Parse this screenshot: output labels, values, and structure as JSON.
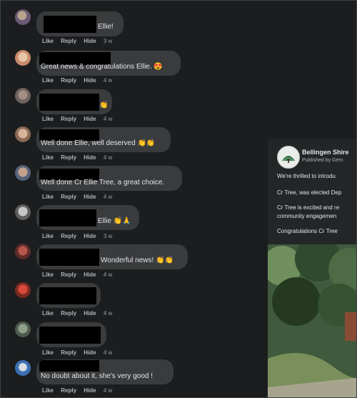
{
  "comments": [
    {
      "text": "Ellie!",
      "actions": {
        "like": "Like",
        "reply": "Reply",
        "hide": "Hide",
        "time": "3 w"
      }
    },
    {
      "text": "Great news & congratulations Ellie. 😍",
      "actions": {
        "like": "Like",
        "reply": "Reply",
        "hide": "Hide",
        "time": "4 w"
      }
    },
    {
      "text": "👏",
      "actions": {
        "like": "Like",
        "reply": "Reply",
        "hide": "Hide",
        "time": "4 w"
      }
    },
    {
      "text": "Well done Ellie, well deserved 👏👏",
      "actions": {
        "like": "Like",
        "reply": "Reply",
        "hide": "Hide",
        "time": "4 w"
      }
    },
    {
      "text": "Well done Cr Ellie Tree, a great choice.",
      "actions": {
        "like": "Like",
        "reply": "Reply",
        "hide": "Hide",
        "time": "4 w"
      }
    },
    {
      "text": "Ellie 👏🙏",
      "actions": {
        "like": "Like",
        "reply": "Reply",
        "hide": "Hide",
        "time": "3 w"
      }
    },
    {
      "text": "Wonderful news! 👏👏",
      "actions": {
        "like": "Like",
        "reply": "Reply",
        "hide": "Hide",
        "time": "4 w"
      }
    },
    {
      "text": "",
      "actions": {
        "like": "Like",
        "reply": "Reply",
        "hide": "Hide",
        "time": "4 w"
      }
    },
    {
      "text": "",
      "actions": {
        "like": "Like",
        "reply": "Reply",
        "hide": "Hide",
        "time": "4 w"
      }
    },
    {
      "text": "No doubt about it, she's very good !",
      "actions": {
        "like": "Like",
        "reply": "Reply",
        "hide": "Hide",
        "time": "4 w"
      }
    }
  ],
  "post": {
    "page_name": "Bellingen Shire",
    "published_by": "Published by Gem",
    "paragraphs": [
      "We're thrilled to introdu",
      "Cr Tree, was elected Dep",
      "Cr Tree is excited and re",
      "community engagemen",
      "Congratulations Cr Tree"
    ]
  },
  "colors": {
    "background": "#1c1d1f",
    "bubble": "#3a3b3c",
    "text": "#e4e6eb",
    "secondary_text": "#b0b3b8",
    "redaction": "#000000"
  }
}
